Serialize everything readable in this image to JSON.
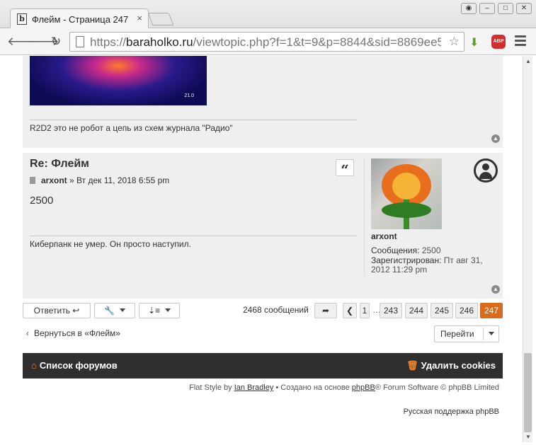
{
  "browser": {
    "tab_title": "Флейм - Страница 247",
    "tab_close": "×",
    "url_scheme": "https://",
    "url_host": "baraholko.ru",
    "url_path": "/viewtopic.php?f=1&t=9&p=8844&sid=8869ee5",
    "abp_label": "ABP"
  },
  "post_prev": {
    "image_badge": "21.0",
    "signature": "R2D2 это не робот а цепь из схем журнала \"Радио\""
  },
  "post": {
    "title": "Re: Флейм",
    "author": "arxont",
    "date": "» Вт дек 11, 2018 6:55 pm",
    "body": "2500",
    "signature": "Киберпанк не умер. Он просто наступил.",
    "profile": {
      "username": "arxont",
      "posts_label": "Сообщения:",
      "posts_value": "2500",
      "registered_label": "Зарегистрирован:",
      "registered_value": "Пт авг 31, 2012 11:29 pm"
    }
  },
  "actions": {
    "reply_label": "Ответить",
    "post_count": "2468 сообщений",
    "pages": [
      "1",
      "…",
      "243",
      "244",
      "245",
      "246",
      "247"
    ],
    "active_page": "247"
  },
  "nav": {
    "back_label": "Вернуться в «Флейм»",
    "jump_label": "Перейти"
  },
  "footer": {
    "forums_label": "Список форумов",
    "cookies_label": "Удалить cookies",
    "credits_style": "Flat Style by ",
    "credits_author": "Ian Bradley",
    "credits_mid": " • Создано на основе ",
    "credits_phpbb": "phpBB",
    "credits_end": "® Forum Software © phpBB Limited",
    "credits_lang": "Русская поддержка phpBB"
  },
  "colors": {
    "accent": "#d86b1c",
    "footer_bg": "#2f2f2f",
    "post_bg": "#efefef"
  }
}
